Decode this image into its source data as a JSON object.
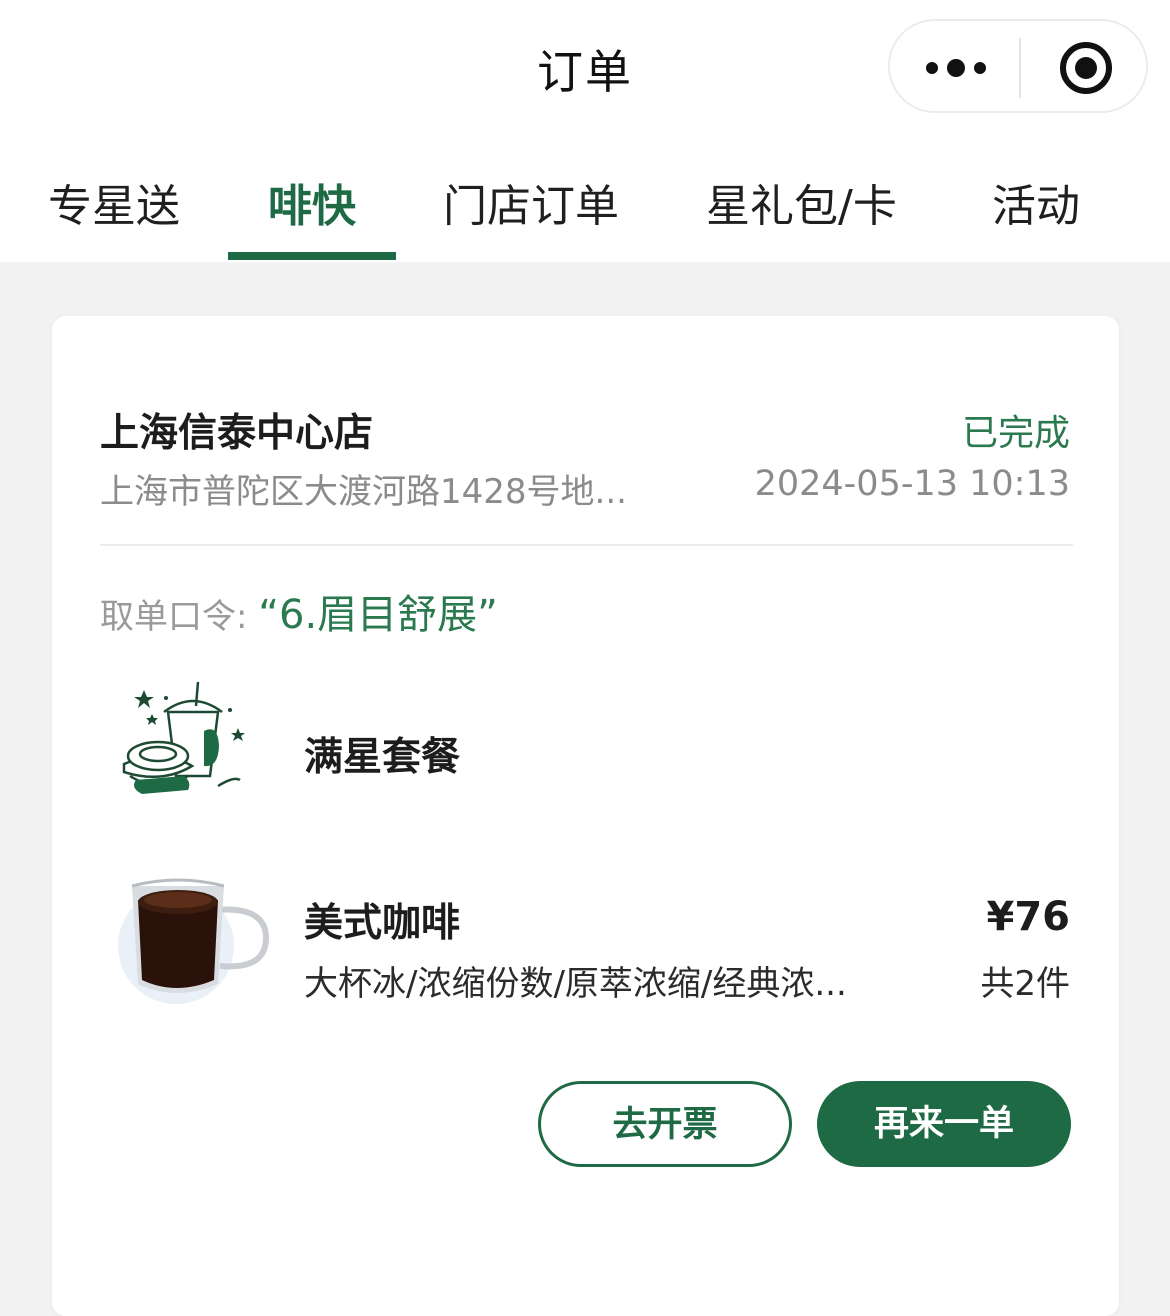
{
  "header": {
    "title": "订单",
    "more_icon": "more-dots-icon",
    "close_icon": "target-circle-icon"
  },
  "tabs": [
    {
      "label": "专星送",
      "active": false
    },
    {
      "label": "啡快",
      "active": true
    },
    {
      "label": "门店订单",
      "active": false
    },
    {
      "label": "星礼包/卡",
      "active": false
    },
    {
      "label": "活动",
      "active": false
    }
  ],
  "order": {
    "store_name": "上海信泰中心店",
    "address": "上海市普陀区大渡河路1428号地...",
    "status": "已完成",
    "time": "2024-05-13 10:13",
    "pickup_label": "取单口令:",
    "pickup_code": "“6.眉目舒展”",
    "items": [
      {
        "name": "满星套餐",
        "icon": "combo-meal-icon"
      },
      {
        "name": "美式咖啡",
        "desc": "大杯冰/浓缩份数/原萃浓缩/经典浓...",
        "icon": "americano-cup-icon"
      }
    ],
    "price": "¥76",
    "quantity": "共2件",
    "invoice_button": "去开票",
    "reorder_button": "再来一单"
  },
  "colors": {
    "accent": "#1e6a44",
    "status_green": "#2b7a4f",
    "background": "#f2f2f2"
  }
}
